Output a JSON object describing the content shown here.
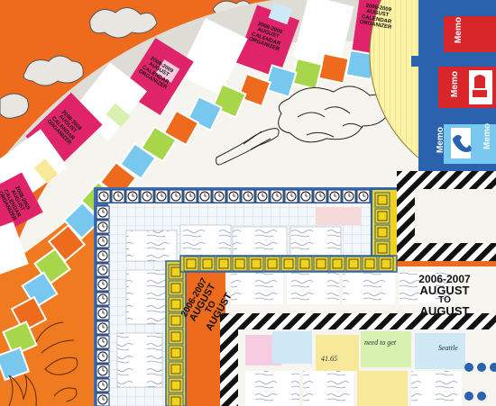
{
  "scene": {
    "description_palette": {
      "orange": "#ee6a1c",
      "magenta": "#e0246a",
      "sky": "#78c7ef",
      "lime": "#a8d64a",
      "yellow_disc": "#fbf3a8",
      "frame_blue": "#2b62ad",
      "frame_yellow": "#f1d21c",
      "red": "#d8262a",
      "paper": "#f7f5f0"
    }
  },
  "texts": {
    "cal_year_a": "2008-2009",
    "cal_words_a": "AUGUST CALENDAR ORGANIZER",
    "cal_year_b": "2008-2009",
    "cal_words_b": "AUGUST CALENDAR ORGANIZER",
    "cal_year_c": "2008-2009",
    "cal_words_c": "AUGUST CALENDAR ORGANIZER",
    "cal_year_d": "2008-2009",
    "cal_words_d": "AUGUST CALENDAR ORGANIZER",
    "cal_year_e": "2008-2009",
    "cal_words_e": "AUGUST CALENDAR ORGANIZER",
    "memo_1": "Memo",
    "memo_2": "Memo",
    "memo_3": "Memo",
    "memo_4": "Memo",
    "year_left": "2006-2007",
    "aug_left_1": "AUGUST",
    "aug_left_2": "TO",
    "aug_left_3": "AUGUST",
    "year_right": "2006-2007",
    "aug_right_1": "AUGUST",
    "aug_right_2": "TO",
    "aug_right_3": "AUGUST",
    "sticky_1": "need to get",
    "sticky_2": "41.65",
    "sticky_3": "Seattle"
  }
}
